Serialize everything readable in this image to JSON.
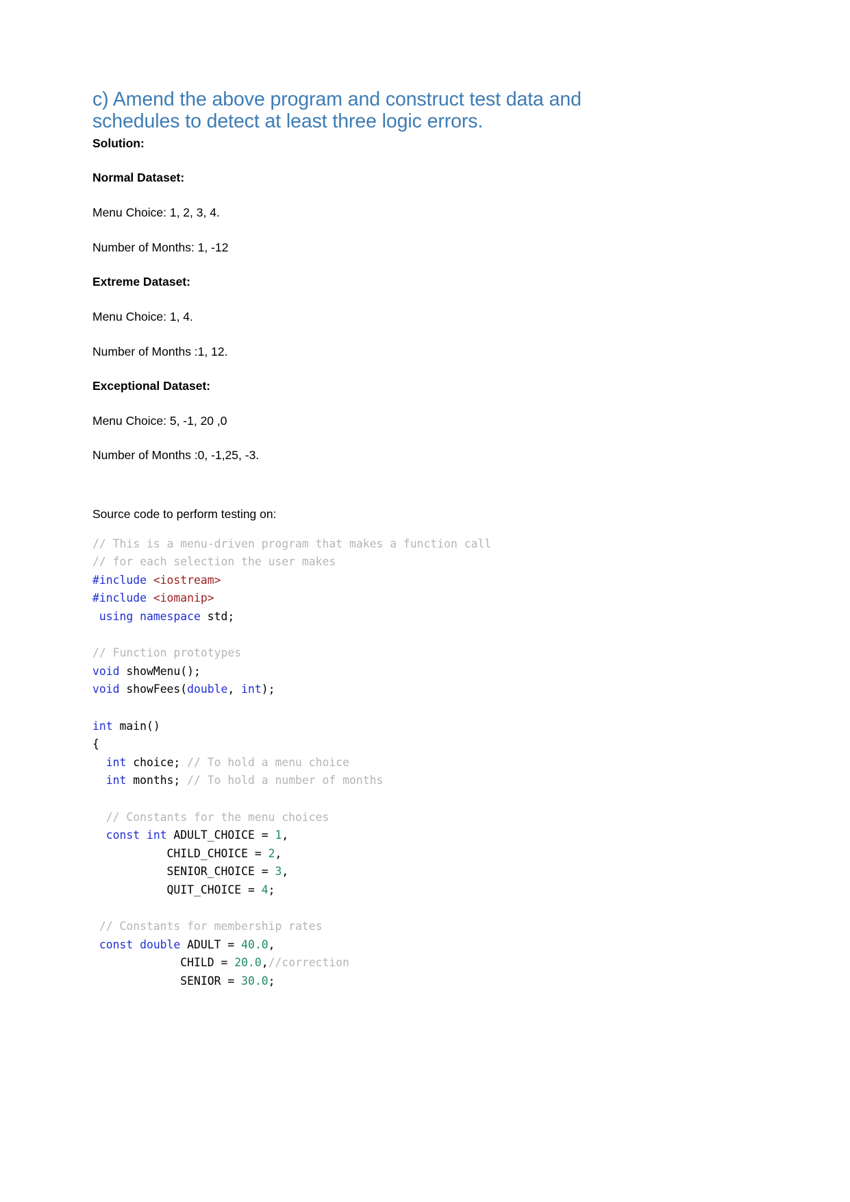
{
  "document": {
    "heading": "c) Amend the above program and construct test data and schedules to detect at least three logic errors.",
    "solution_label": "Solution:",
    "sections": [
      {
        "title": "Normal Dataset:",
        "lines": [
          "Menu Choice: 1, 2, 3, 4.",
          "Number of Months: 1, -12"
        ]
      },
      {
        "title": "Extreme Dataset:",
        "lines": [
          "Menu Choice: 1, 4.",
          "Number of Months :1, 12."
        ]
      },
      {
        "title": "Exceptional Dataset:",
        "lines": [
          "Menu Choice: 5, -1, 20 ,0",
          "Number of Months :0, -1,25, -3."
        ]
      }
    ],
    "source_code_caption": "Source code to perform testing on:",
    "code_lines": [
      {
        "segments": [
          {
            "t": "// This is a menu-driven program that makes a function call",
            "c": "cm"
          }
        ]
      },
      {
        "segments": [
          {
            "t": "// for each selection the user makes",
            "c": "cm"
          }
        ]
      },
      {
        "segments": [
          {
            "t": "#include ",
            "c": "inc"
          },
          {
            "t": "<iostream>",
            "c": "hdr"
          }
        ]
      },
      {
        "segments": [
          {
            "t": "#include ",
            "c": "inc"
          },
          {
            "t": "<iomanip>",
            "c": "hdr"
          }
        ]
      },
      {
        "segments": [
          {
            "t": " ",
            "c": "pl"
          },
          {
            "t": "using namespace",
            "c": "kw"
          },
          {
            "t": " std;",
            "c": "pl"
          }
        ]
      },
      {
        "segments": [
          {
            "t": "",
            "c": "pl"
          }
        ]
      },
      {
        "segments": [
          {
            "t": "// Function prototypes",
            "c": "cm"
          }
        ]
      },
      {
        "segments": [
          {
            "t": "void",
            "c": "kw"
          },
          {
            "t": " showMenu();",
            "c": "pl"
          }
        ]
      },
      {
        "segments": [
          {
            "t": "void",
            "c": "kw"
          },
          {
            "t": " showFees(",
            "c": "pl"
          },
          {
            "t": "double",
            "c": "kw"
          },
          {
            "t": ", ",
            "c": "pl"
          },
          {
            "t": "int",
            "c": "kw"
          },
          {
            "t": ");",
            "c": "pl"
          }
        ]
      },
      {
        "segments": [
          {
            "t": "",
            "c": "pl"
          }
        ]
      },
      {
        "segments": [
          {
            "t": "int",
            "c": "kw"
          },
          {
            "t": " main()",
            "c": "pl"
          }
        ]
      },
      {
        "segments": [
          {
            "t": "{",
            "c": "pl"
          }
        ]
      },
      {
        "segments": [
          {
            "t": "  ",
            "c": "pl"
          },
          {
            "t": "int",
            "c": "kw"
          },
          {
            "t": " choice; ",
            "c": "pl"
          },
          {
            "t": "// To hold a menu choice",
            "c": "cm"
          }
        ]
      },
      {
        "segments": [
          {
            "t": "  ",
            "c": "pl"
          },
          {
            "t": "int",
            "c": "kw"
          },
          {
            "t": " months; ",
            "c": "pl"
          },
          {
            "t": "// To hold a number of months",
            "c": "cm"
          }
        ]
      },
      {
        "segments": [
          {
            "t": "",
            "c": "pl"
          }
        ]
      },
      {
        "segments": [
          {
            "t": "  ",
            "c": "pl"
          },
          {
            "t": "// Constants for the menu choices",
            "c": "cm"
          }
        ]
      },
      {
        "segments": [
          {
            "t": "  ",
            "c": "pl"
          },
          {
            "t": "const int",
            "c": "kw"
          },
          {
            "t": " ADULT_CHOICE = ",
            "c": "pl"
          },
          {
            "t": "1",
            "c": "num"
          },
          {
            "t": ",",
            "c": "pl"
          }
        ]
      },
      {
        "segments": [
          {
            "t": "           CHILD_CHOICE = ",
            "c": "pl"
          },
          {
            "t": "2",
            "c": "num"
          },
          {
            "t": ",",
            "c": "pl"
          }
        ]
      },
      {
        "segments": [
          {
            "t": "           SENIOR_CHOICE = ",
            "c": "pl"
          },
          {
            "t": "3",
            "c": "num"
          },
          {
            "t": ",",
            "c": "pl"
          }
        ]
      },
      {
        "segments": [
          {
            "t": "           QUIT_CHOICE = ",
            "c": "pl"
          },
          {
            "t": "4",
            "c": "num"
          },
          {
            "t": ";",
            "c": "pl"
          }
        ]
      },
      {
        "segments": [
          {
            "t": "",
            "c": "pl"
          }
        ]
      },
      {
        "segments": [
          {
            "t": " ",
            "c": "pl"
          },
          {
            "t": "// Constants for membership rates",
            "c": "cm"
          }
        ]
      },
      {
        "segments": [
          {
            "t": " ",
            "c": "pl"
          },
          {
            "t": "const double",
            "c": "kw"
          },
          {
            "t": " ADULT = ",
            "c": "pl"
          },
          {
            "t": "40.0",
            "c": "num"
          },
          {
            "t": ",",
            "c": "pl"
          }
        ]
      },
      {
        "segments": [
          {
            "t": "             CHILD = ",
            "c": "pl"
          },
          {
            "t": "20.0",
            "c": "num"
          },
          {
            "t": ",",
            "c": "pl"
          },
          {
            "t": "//correction",
            "c": "cm"
          }
        ]
      },
      {
        "segments": [
          {
            "t": "             SENIOR = ",
            "c": "pl"
          },
          {
            "t": "30.0",
            "c": "num"
          },
          {
            "t": ";",
            "c": "pl"
          }
        ]
      }
    ]
  },
  "colors": {
    "heading": "#3d7cb5",
    "comment": "#b5b5b5",
    "keyword": "#1f2fd0",
    "header_include": "#9c2020",
    "number": "#1e8a62",
    "text": "#000000",
    "background": "#ffffff"
  }
}
